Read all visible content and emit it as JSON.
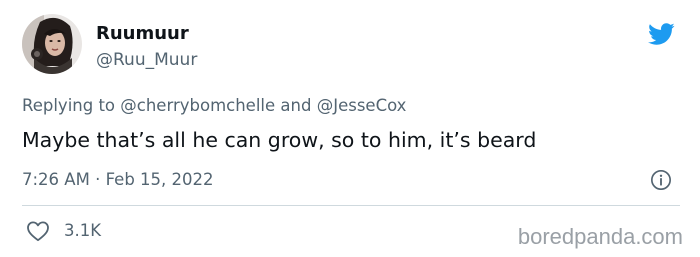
{
  "author": {
    "display_name": "Ruumuur",
    "handle": "@Ruu_Muur",
    "avatar_icon": "avatar-photo"
  },
  "reply": {
    "prefix": "Replying to",
    "mention_1": "@cherrybomchelle",
    "joiner": "and",
    "mention_2": "@JesseCox"
  },
  "tweet": {
    "text": "Maybe that’s all he can grow, so to him, it’s beard",
    "time": "7:26 AM",
    "separator": "·",
    "date": "Feb 15, 2022"
  },
  "stats": {
    "likes": "3.1K"
  },
  "watermark": "boredpanda.com",
  "colors": {
    "twitter_blue": "#1d9bf0",
    "text_primary": "#0f1419",
    "text_secondary": "#536471",
    "divider": "#cfd9de",
    "watermark": "#9aa0a6"
  },
  "icons": {
    "brand": "twitter-bird-icon",
    "info": "info-icon",
    "like": "heart-icon"
  }
}
